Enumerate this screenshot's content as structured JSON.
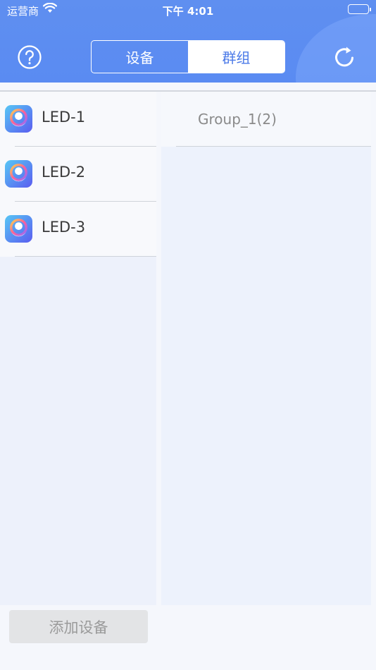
{
  "status_bar": {
    "carrier": "运营商",
    "time": "下午 4:01"
  },
  "header": {
    "segments": [
      {
        "label": "设备",
        "selected": false
      },
      {
        "label": "群组",
        "selected": true
      }
    ],
    "help_icon": "question-circle-icon",
    "refresh_icon": "refresh-icon"
  },
  "devices": [
    {
      "label": "LED-1",
      "icon": "led-app-icon"
    },
    {
      "label": "LED-2",
      "icon": "led-app-icon"
    },
    {
      "label": "LED-3",
      "icon": "led-app-icon"
    }
  ],
  "groups": [
    {
      "label": "Group_1(2)"
    }
  ],
  "footer": {
    "add_device_label": "添加设备"
  },
  "colors": {
    "header": "#5a8bf2",
    "segment_selected_text": "#4b7ae8",
    "background": "#f5f7fc"
  }
}
